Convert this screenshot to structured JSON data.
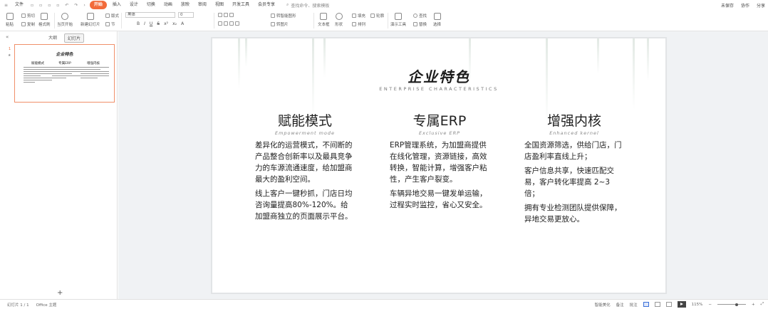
{
  "menu": {
    "file": "文件",
    "items": [
      "开始",
      "插入",
      "设计",
      "切换",
      "动画",
      "放映",
      "审阅",
      "视图",
      "开发工具",
      "会员专享"
    ],
    "active_index": 0,
    "search_label": "查找命令、搜索模板",
    "right": [
      "未保存",
      "协作",
      "分享"
    ]
  },
  "ribbon": {
    "paste": "粘贴",
    "cut": "剪切",
    "copy": "复制",
    "format_painter": "格式刷",
    "from_current": "当页开始",
    "new_slide": "新建幻灯片",
    "layout": "版式",
    "section": "节",
    "font_name": "黑体",
    "font_size": "0",
    "text_box": "文本框",
    "shape": "形状",
    "arrange": "排列",
    "show_tools": "演示工具",
    "replace": "替换",
    "select": "选择",
    "smart_graphic": "转智能图形",
    "convert_pic": "转图片",
    "find": "查找",
    "outline": "轮廓",
    "fill": "填充"
  },
  "left_panel": {
    "tabs": [
      "大纲",
      "幻灯片"
    ],
    "active_tab": 1,
    "slide_number": "1"
  },
  "slide": {
    "title": "企业特色",
    "subtitle": "ENTERPRISE CHARACTERISTICS",
    "columns": [
      {
        "heading": "赋能模式",
        "en": "Empowerment mode",
        "paragraphs": [
          "差异化的运营模式，不间断的产品整合创新率以及最具竞争力的车源流通速度，给加盟商最大的盈利空间。",
          "线上客户一键秒抓，门店日均咨询量提高80%-120%。给加盟商独立的页面展示平台。"
        ]
      },
      {
        "heading": "专属ERP",
        "en": "Exclusive ERP",
        "paragraphs": [
          "ERP管理系统，为加盟商提供在线化管理，资源链接，高效转换，智能计算，增强客户粘性，产生客户裂变。",
          "车辆异地交易一键发单运输，过程实时监控，省心又安全。"
        ]
      },
      {
        "heading": "增强内核",
        "en": "Enhanced kernel",
        "paragraphs": [
          "全国资源筛选，供给门店，门店盈利率直线上升；",
          "客户信息共享，快速匹配交易，客户转化率提高 2~3 倍；",
          "拥有专业检测团队提供保障，异地交易更放心。"
        ]
      }
    ]
  },
  "status": {
    "slide_info": "幻灯片 1 / 1",
    "theme": "Office 主题",
    "beautify": "智能美化",
    "notes": "备注",
    "comments": "批注",
    "zoom": "115%",
    "zoom_fraction": 0.62
  },
  "colors": {
    "accent": "#f26b3a",
    "slide_border": "#e2e4e6",
    "canvas_bg": "#f0f2f4"
  }
}
